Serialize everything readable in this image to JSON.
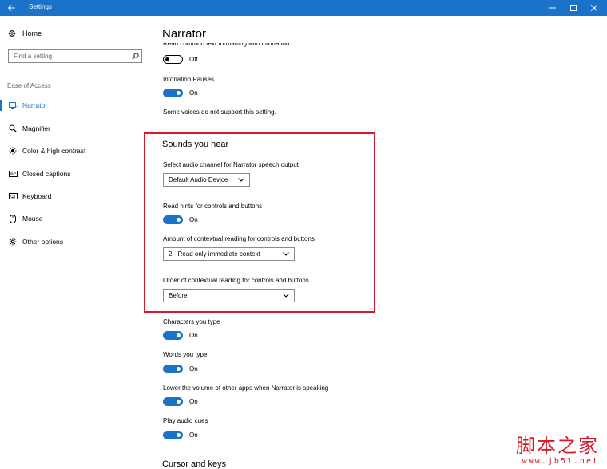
{
  "window": {
    "title": "Settings"
  },
  "sidebar": {
    "home_label": "Home",
    "search_placeholder": "Find a setting",
    "section_label": "Ease of Access",
    "items": [
      {
        "label": "Narrator",
        "icon": "narrator-icon",
        "active": true
      },
      {
        "label": "Magnifier",
        "icon": "magnifier-icon"
      },
      {
        "label": "Color & high contrast",
        "icon": "color-contrast-icon"
      },
      {
        "label": "Closed captions",
        "icon": "closed-captions-icon"
      },
      {
        "label": "Keyboard",
        "icon": "keyboard-icon"
      },
      {
        "label": "Mouse",
        "icon": "mouse-icon"
      },
      {
        "label": "Other options",
        "icon": "other-options-icon"
      }
    ]
  },
  "main": {
    "title": "Narrator",
    "cut_setting_label": "Read common text formatting with intonation",
    "cut_setting_state": "Off",
    "intonation": {
      "label": "Intonation Pauses",
      "state": "On"
    },
    "note": "Some voices do not support this setting.",
    "sounds": {
      "title": "Sounds you hear",
      "audio_channel_label": "Select audio channel for Narrator speech output",
      "audio_channel_value": "Default Audio Device",
      "read_hints_label": "Read hints for controls and buttons",
      "read_hints_state": "On",
      "amount_label": "Amount of contextual reading for controls and buttons",
      "amount_value": "2 - Read only immediate context",
      "order_label": "Order of contextual reading for controls and buttons",
      "order_value": "Before"
    },
    "characters": {
      "label": "Characters you type",
      "state": "On"
    },
    "words": {
      "label": "Words you type",
      "state": "On"
    },
    "lower_volume": {
      "label": "Lower the volume of other apps when Narrator is speaking",
      "state": "On"
    },
    "audio_cues": {
      "label": "Play audio cues",
      "state": "On"
    },
    "next_section_title": "Cursor and keys"
  },
  "watermark": {
    "cn": "脚本之家",
    "url": "www.jb51.net"
  },
  "colors": {
    "accent": "#1a73c8",
    "highlight": "#d7192b"
  }
}
